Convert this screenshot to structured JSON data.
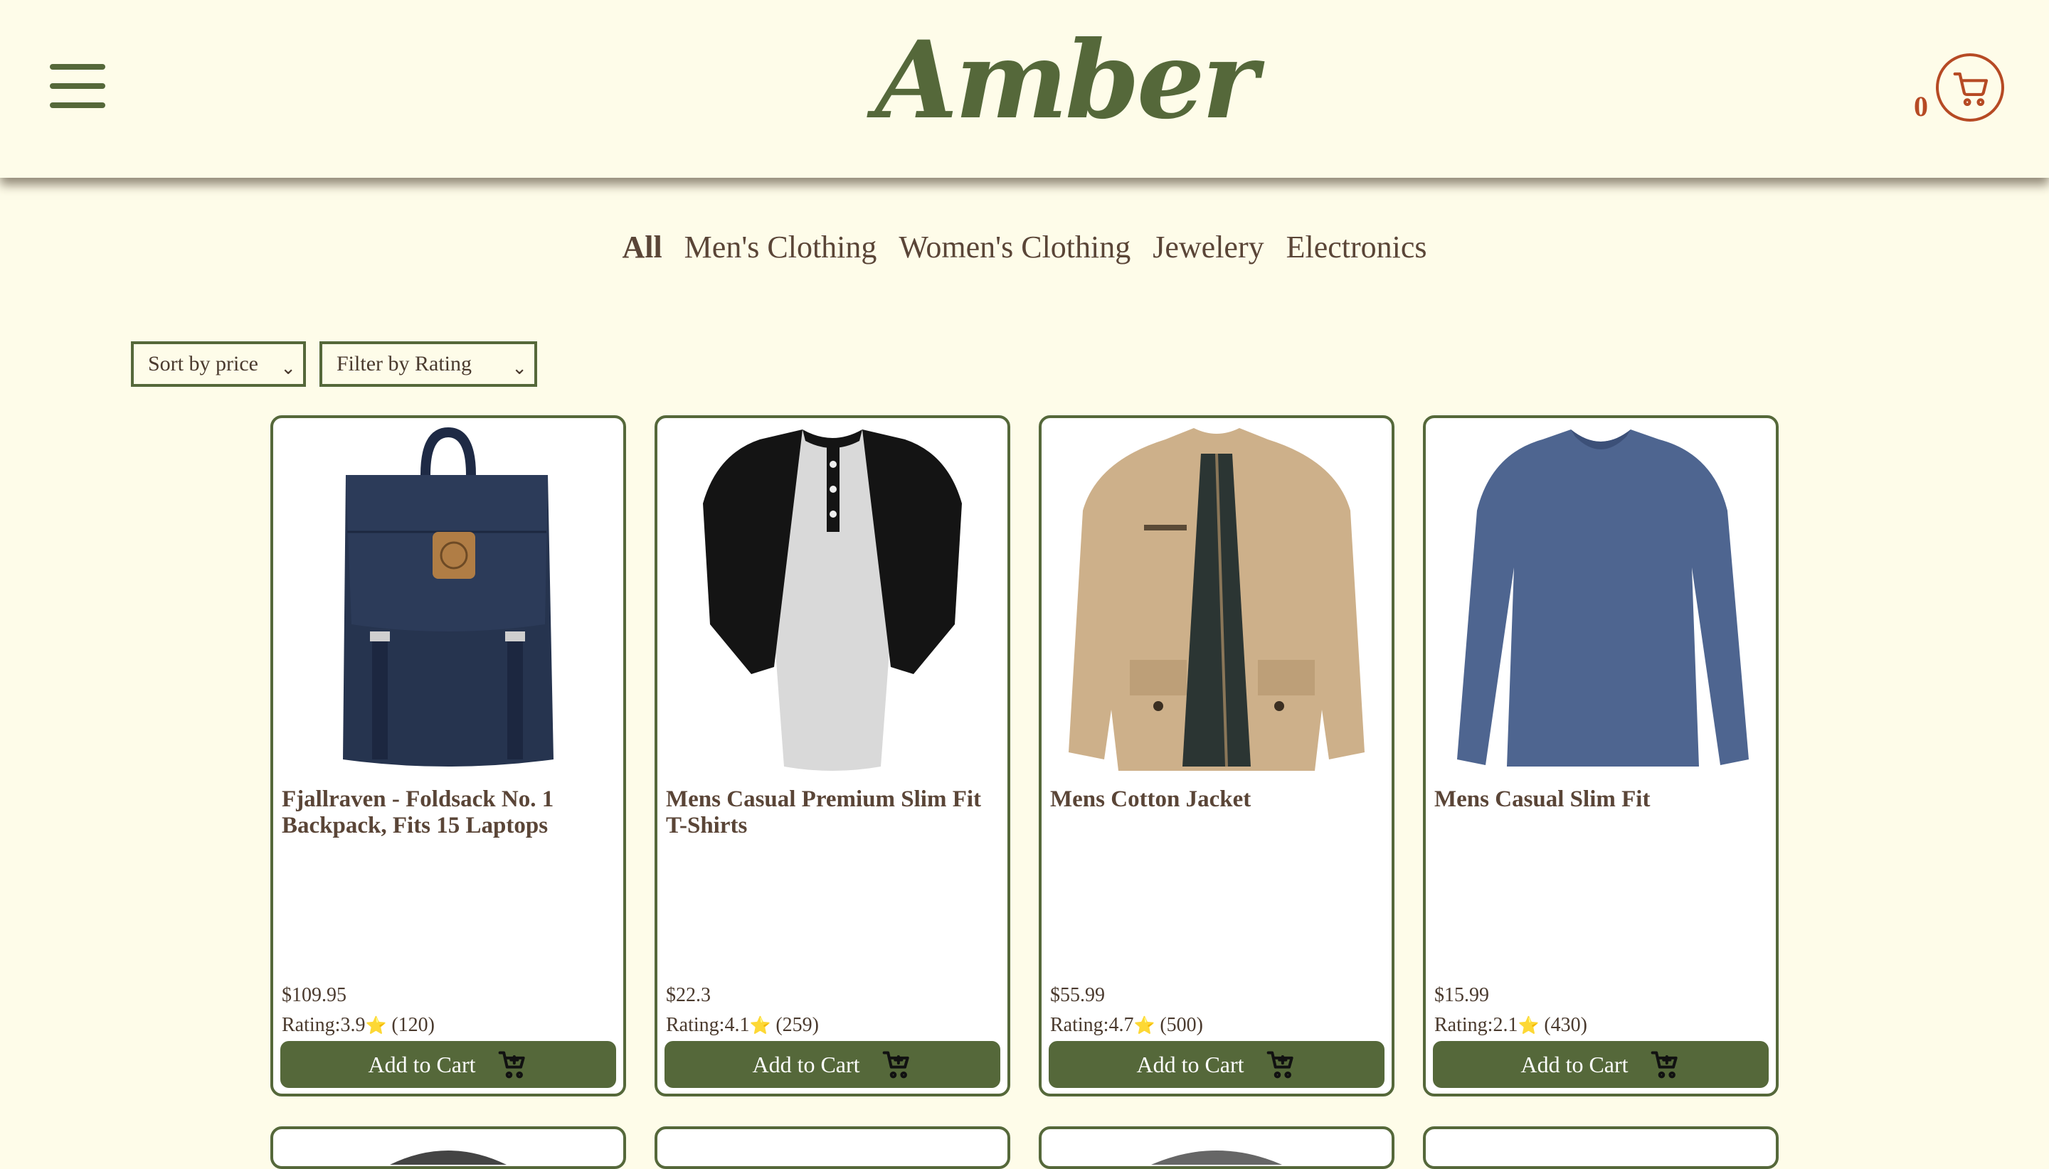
{
  "header": {
    "logo": "Amber",
    "cart_count": "0",
    "menu_icon": "hamburger-icon",
    "cart_icon": "shopping-cart-icon"
  },
  "categories": [
    "All",
    "Men's Clothing",
    "Women's Clothing",
    "Jewelery",
    "Electronics"
  ],
  "active_category": "All",
  "filters": {
    "sort_label": "Sort by price",
    "rating_label": "Filter by Rating"
  },
  "colors": {
    "accent_green": "#55683a",
    "cart_red": "#b64a24",
    "background": "#fefce9",
    "text_brown": "#5a4537"
  },
  "products": [
    {
      "title": "Fjallraven - Foldsack No. 1 Backpack, Fits 15 Laptops",
      "price": "$109.95",
      "rating_prefix": "Rating:3.9",
      "rating_count": "(120)",
      "button": "Add to Cart",
      "image": "navy-backpack"
    },
    {
      "title": "Mens Casual Premium Slim Fit T-Shirts",
      "price": "$22.3",
      "rating_prefix": "Rating:4.1",
      "rating_count": "(259)",
      "button": "Add to Cart",
      "image": "raglan-henley-shirt"
    },
    {
      "title": "Mens Cotton Jacket",
      "price": "$55.99",
      "rating_prefix": "Rating:4.7",
      "rating_count": "(500)",
      "button": "Add to Cart",
      "image": "beige-cotton-jacket"
    },
    {
      "title": "Mens Casual Slim Fit",
      "price": "$15.99",
      "rating_prefix": "Rating:2.1",
      "rating_count": "(430)",
      "button": "Add to Cart",
      "image": "blue-long-sleeve-shirt"
    }
  ]
}
